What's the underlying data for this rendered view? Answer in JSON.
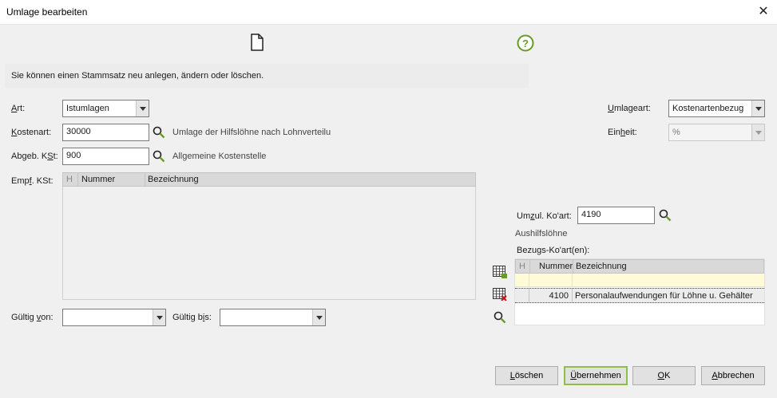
{
  "window": {
    "title": "Umlage bearbeiten",
    "close_label": "✕"
  },
  "toolbar": {
    "new_icon": "new-document-icon",
    "help_icon": "help-icon"
  },
  "info_text": "Sie können einen Stammsatz neu anlegen, ändern oder löschen.",
  "form": {
    "art": {
      "label_pre": "",
      "label_u": "A",
      "label_post": "rt:",
      "value": "Istumlagen"
    },
    "kostenart": {
      "label_pre": "",
      "label_u": "K",
      "label_post": "ostenart:",
      "value": "30000",
      "description": "Umlage der Hilfslöhne nach Lohnverteilu"
    },
    "abgeb_kst": {
      "label_pre": "Abgeb. K",
      "label_u": "S",
      "label_post": "t:",
      "value": "900",
      "description": "Allgemeine Kostenstelle"
    },
    "empf_kst": {
      "label_pre": "Emp",
      "label_u": "f",
      "label_post": ". KSt:",
      "columns": {
        "h": "H",
        "nummer": "Nummer",
        "bezeichnung": "Bezeichnung"
      }
    },
    "gueltig_von": {
      "label_pre": "Gültig ",
      "label_u": "v",
      "label_post": "on:",
      "value": ""
    },
    "gueltig_bis": {
      "label_pre": "Gültig b",
      "label_u": "i",
      "label_post": "s:",
      "value": ""
    },
    "umlageart": {
      "label_pre": "",
      "label_u": "U",
      "label_post": "mlageart:",
      "value": "Kostenartenbezug"
    },
    "einheit": {
      "label_pre": "Ein",
      "label_u": "h",
      "label_post": "eit:",
      "value": "%"
    },
    "umzul_koart": {
      "label_pre": "Um",
      "label_u": "z",
      "label_post": "ul. Ko'art:",
      "value": "4190",
      "description": "Aushilfslöhne"
    },
    "bezugs": {
      "label": "Bezugs-Ko'art(en):",
      "columns": {
        "h": "H",
        "nummer": "Nummer",
        "bezeichnung": "Bezeichnung"
      },
      "rows": [
        {
          "nummer": "",
          "bezeichnung": ""
        },
        {
          "nummer": "4100",
          "bezeichnung": "Personalaufwendungen für Löhne u. Gehälter"
        }
      ]
    }
  },
  "buttons": {
    "loeschen": {
      "pre": "",
      "u": "L",
      "post": "öschen"
    },
    "uebernehmen": {
      "pre": "",
      "u": "Ü",
      "post": "bernehmen"
    },
    "ok": {
      "pre": "",
      "u": "O",
      "post": "K"
    },
    "abbrechen": {
      "pre": "",
      "u": "A",
      "post": "bbrechen"
    }
  },
  "colors": {
    "accent_border": "#8ebf4a",
    "highlight_row": "#fffbd6"
  }
}
